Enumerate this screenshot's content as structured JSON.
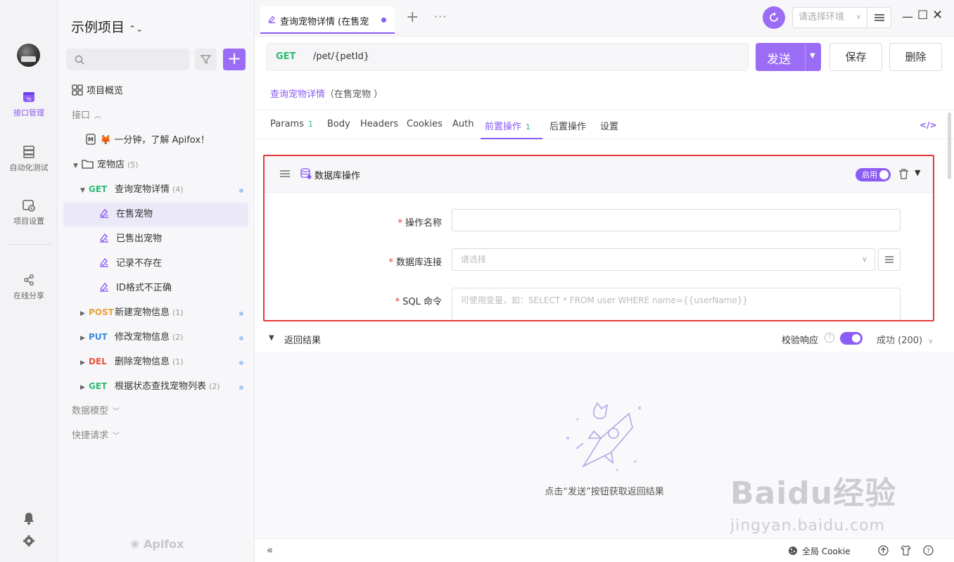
{
  "rail": {
    "items": [
      {
        "label": "接口管理",
        "icon": "api-management-icon",
        "active": true
      },
      {
        "label": "自动化测试",
        "icon": "automation-test-icon"
      },
      {
        "label": "项目设置",
        "icon": "project-settings-icon"
      },
      {
        "label": "在线分享",
        "icon": "share-icon"
      }
    ]
  },
  "tree": {
    "project_title": "示例项目",
    "overview_label": "项目概览",
    "interface_section": "接口",
    "intro_doc": "🦊 一分钟，了解 Apifox！",
    "folder": {
      "name": "宠物店",
      "count": "(5)"
    },
    "endpoints": [
      {
        "method": "GET",
        "name": "查询宠物详情",
        "count": "(4)"
      },
      {
        "method": "POST",
        "name": "新建宠物信息",
        "count": "(1)"
      },
      {
        "method": "PUT",
        "name": "修改宠物信息",
        "count": "(2)"
      },
      {
        "method": "DEL",
        "name": "删除宠物信息",
        "count": "(1)"
      },
      {
        "method": "GET",
        "name": "根据状态查找宠物列表",
        "count": "(2)"
      }
    ],
    "cases": [
      "在售宠物",
      "已售出宠物",
      "记录不存在",
      "ID格式不正确"
    ],
    "data_model_section": "数据模型",
    "quick_request_section": "快捷请求",
    "logo_text": "Apifox"
  },
  "tabbar": {
    "tab_label": "查询宠物详情 (在售宠",
    "env_placeholder": "请选择环境"
  },
  "request": {
    "method": "GET",
    "path": "/pet/{petId}",
    "send_label": "发送",
    "save_label": "保存",
    "delete_label": "删除",
    "title": "查询宠物详情",
    "subtitle": "（在售宠物 ）"
  },
  "req_tabs": [
    {
      "label": "Params",
      "count": "1"
    },
    {
      "label": "Body",
      "count": ""
    },
    {
      "label": "Headers",
      "count": ""
    },
    {
      "label": "Cookies",
      "count": ""
    },
    {
      "label": "Auth",
      "count": ""
    },
    {
      "label": "前置操作",
      "count": "1"
    },
    {
      "label": "后置操作",
      "count": ""
    },
    {
      "label": "设置",
      "count": ""
    }
  ],
  "db_op": {
    "title": "数据库操作",
    "toggle_label": "启用",
    "fields": {
      "name_label": "操作名称",
      "conn_label": "数据库连接",
      "conn_placeholder": "请选择",
      "sql_label": "SQL 命令",
      "sql_placeholder": "可使用变量，如：SELECT * FROM user WHERE name={{userName}}"
    }
  },
  "response": {
    "title": "返回结果",
    "validate_label": "校验响应",
    "status": "成功 (200)",
    "hint": "点击“发送”按钮获取返回结果"
  },
  "statusbar": {
    "cookie_label": "全局 Cookie"
  },
  "watermark": {
    "line1": "Baidu经验",
    "line2": "jingyan.baidu.com"
  },
  "colors": {
    "accent": "#8b5cf6",
    "get": "#2eb872",
    "post": "#e8a23a",
    "put": "#3b8bd9",
    "del": "#e5533c",
    "highlight_border": "#e53935"
  }
}
